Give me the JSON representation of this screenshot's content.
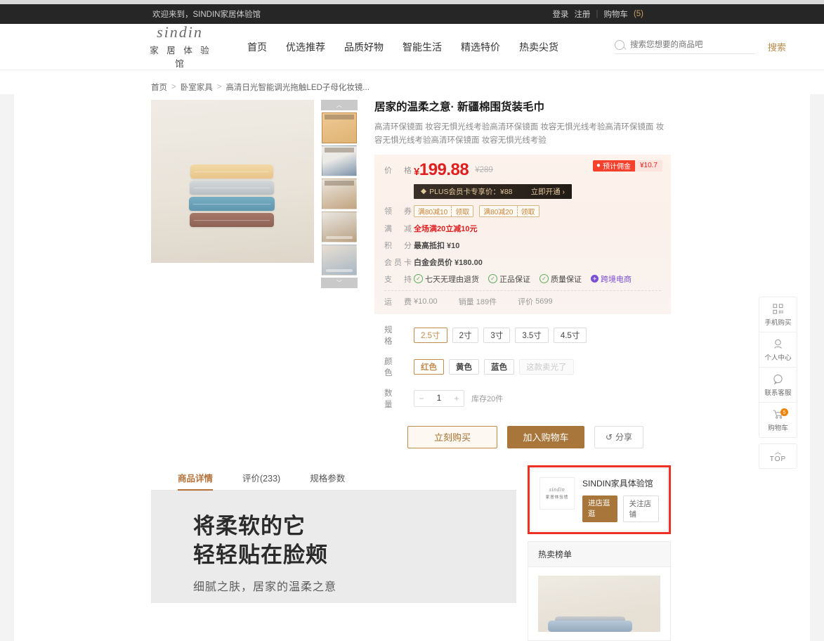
{
  "browser": {
    "ghost_text": ""
  },
  "topbar": {
    "welcome": "欢迎来到，SINDIN家居体验馆",
    "login": "登录",
    "register": "注册",
    "separator": "|",
    "cart": "购物车",
    "cart_count": "(5)"
  },
  "header": {
    "logo_mark": "sindin",
    "logo_sub": "家 居 体 验 馆",
    "nav": [
      {
        "label": "首页"
      },
      {
        "label": "优选推荐"
      },
      {
        "label": "品质好物"
      },
      {
        "label": "智能生活"
      },
      {
        "label": "精选特价"
      },
      {
        "label": "热卖尖货"
      }
    ],
    "search_placeholder": "搜索您想要的商品吧",
    "search_value": "",
    "search_button": "搜索"
  },
  "breadcrumb": [
    {
      "label": "首页"
    },
    {
      "label": "卧室家具"
    },
    {
      "label": "高清日光智能调光拖触LED子母化妆镜..."
    }
  ],
  "product": {
    "title": "居家的温柔之意· 新疆棉围货装毛巾",
    "subtitle": "高清环保镜面 妆容无惧光线考验高清环保镜面 妆容无惧光线考验高清环保镜面 妆容无惧光线考验高清环保镜面 妆容无惧光线考验",
    "gallery": {
      "up_arrow": "︿",
      "down_arrow": "﹀",
      "thumb_count": 5
    },
    "price": {
      "label": "价　格",
      "currency": "¥",
      "current": "199.88",
      "original": "¥289",
      "commission_label": "预计佣金",
      "commission_value": "¥10.7"
    },
    "plus": {
      "text": "PLUS会员卡专享价：¥88",
      "action": "立即开通 ›"
    },
    "coupon": {
      "label": "领　券",
      "items": [
        {
          "value": "满80减10",
          "action": "领取"
        },
        {
          "value": "满80减20",
          "action": "领取"
        }
      ]
    },
    "discount": {
      "label": "满　减",
      "text": "全场满20立减10元"
    },
    "points": {
      "label": "积　分",
      "text": "最高抵扣 ¥10"
    },
    "membercard": {
      "label": "会员卡",
      "text": "白金会员价 ¥180.00"
    },
    "support": {
      "label": "支　持",
      "items": [
        {
          "text": "七天无理由退货",
          "type": "check"
        },
        {
          "text": "正品保证",
          "type": "check"
        },
        {
          "text": "质量保证",
          "type": "check"
        },
        {
          "text": "跨境电商",
          "type": "globe"
        }
      ]
    },
    "meta": {
      "shipping_label": "运　费",
      "shipping_value": "¥10.00",
      "sales_label": "销量",
      "sales_value": "189件",
      "reviews_label": "评价",
      "reviews_value": "5699"
    },
    "spec": {
      "label": "规　格",
      "options": [
        "2.5寸",
        "2寸",
        "3寸",
        "3.5寸",
        "4.5寸"
      ],
      "selected": "2.5寸"
    },
    "color": {
      "label": "颜　色",
      "options": [
        "红色",
        "黄色",
        "蓝色"
      ],
      "selected": "红色",
      "soldout_label": "这款卖光了"
    },
    "quantity": {
      "label": "数　量",
      "minus": "−",
      "plus": "+",
      "value": "1",
      "stock": "库存20件"
    },
    "actions": {
      "buy": "立刻购买",
      "add_cart": "加入购物车",
      "share": "分享",
      "share_icon": "↺"
    }
  },
  "tabs": [
    {
      "label": "商品详情",
      "active": true
    },
    {
      "label": "评价(233)",
      "active": false
    },
    {
      "label": "规格参数",
      "active": false
    }
  ],
  "detail": {
    "heading_line1": "将柔软的它",
    "heading_line2": "轻轻贴在脸颊",
    "subline": "细腻之肤，居家的温柔之意"
  },
  "shop": {
    "logo_mark": "sindin",
    "logo_sub": "家居体验馆",
    "name": "SINDIN家具体验馆",
    "visit_button": "进店逛逛",
    "follow_button": "关注店铺",
    "highlighted": true,
    "highlight_color": "#ee3124"
  },
  "rank": {
    "title": "热卖榜单"
  },
  "rail": {
    "items": [
      {
        "label": "手机购买",
        "icon": "qrcode-icon",
        "badge": ""
      },
      {
        "label": "个人中心",
        "icon": "user-icon",
        "badge": ""
      },
      {
        "label": "联系客服",
        "icon": "chat-icon",
        "badge": ""
      },
      {
        "label": "购物车",
        "icon": "cart-icon",
        "badge": "5"
      }
    ],
    "top": {
      "caret": "︿",
      "label": "TOP"
    }
  }
}
